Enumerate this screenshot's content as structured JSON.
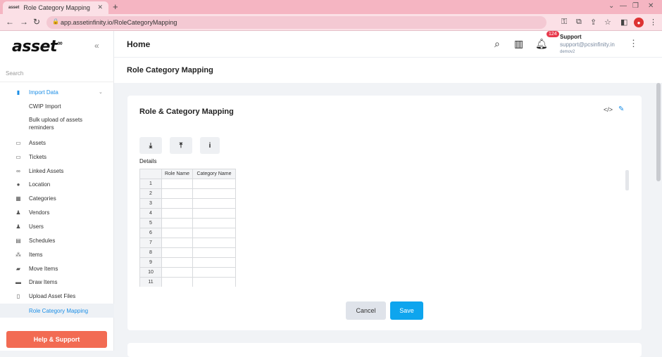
{
  "browser": {
    "tab_title": "Role Category Mapping",
    "tab_favicon": "asset",
    "url": "app.assetinfinity.io/RoleCategoryMapping"
  },
  "sidebar": {
    "logo": "asset",
    "logo_mark": "∞",
    "search_placeholder": "Search",
    "items": [
      {
        "label": "Import Data",
        "icon": "import-icon"
      },
      {
        "label": "CWIP Import"
      },
      {
        "label": "Bulk upload of assets reminders"
      },
      {
        "label": "Assets",
        "icon": "monitor-icon"
      },
      {
        "label": "Tickets",
        "icon": "ticket-icon"
      },
      {
        "label": "Linked Assets",
        "icon": "link-icon"
      },
      {
        "label": "Location",
        "icon": "location-icon"
      },
      {
        "label": "Categories",
        "icon": "categories-icon"
      },
      {
        "label": "Vendors",
        "icon": "vendors-icon"
      },
      {
        "label": "Users",
        "icon": "users-icon"
      },
      {
        "label": "Schedules",
        "icon": "schedules-icon"
      },
      {
        "label": "Items",
        "icon": "items-icon"
      },
      {
        "label": "Move Items",
        "icon": "truck-icon"
      },
      {
        "label": "Draw Items",
        "icon": "draw-icon"
      },
      {
        "label": "Upload Asset Files",
        "icon": "file-icon"
      },
      {
        "label": "Role Category Mapping"
      }
    ],
    "help_button": "Help & Support"
  },
  "header": {
    "title": "Home",
    "notification_count": "124",
    "user_name": "Support",
    "user_email": "support@pcsinfinity.in",
    "user_org": "demov2"
  },
  "page": {
    "title": "Role Category Mapping",
    "card_title": "Role & Category Mapping",
    "details_label": "Details",
    "grid_headers": [
      "Role Name",
      "Category Name"
    ],
    "grid_rows": [
      "1",
      "2",
      "3",
      "4",
      "5",
      "6",
      "7",
      "8",
      "9",
      "10",
      "11"
    ],
    "cancel_label": "Cancel",
    "save_label": "Save"
  },
  "colors": {
    "accent": "#1b8ee6",
    "save": "#0ea5ee",
    "help": "#f26b53",
    "browser_tab": "#f5b5c2"
  }
}
